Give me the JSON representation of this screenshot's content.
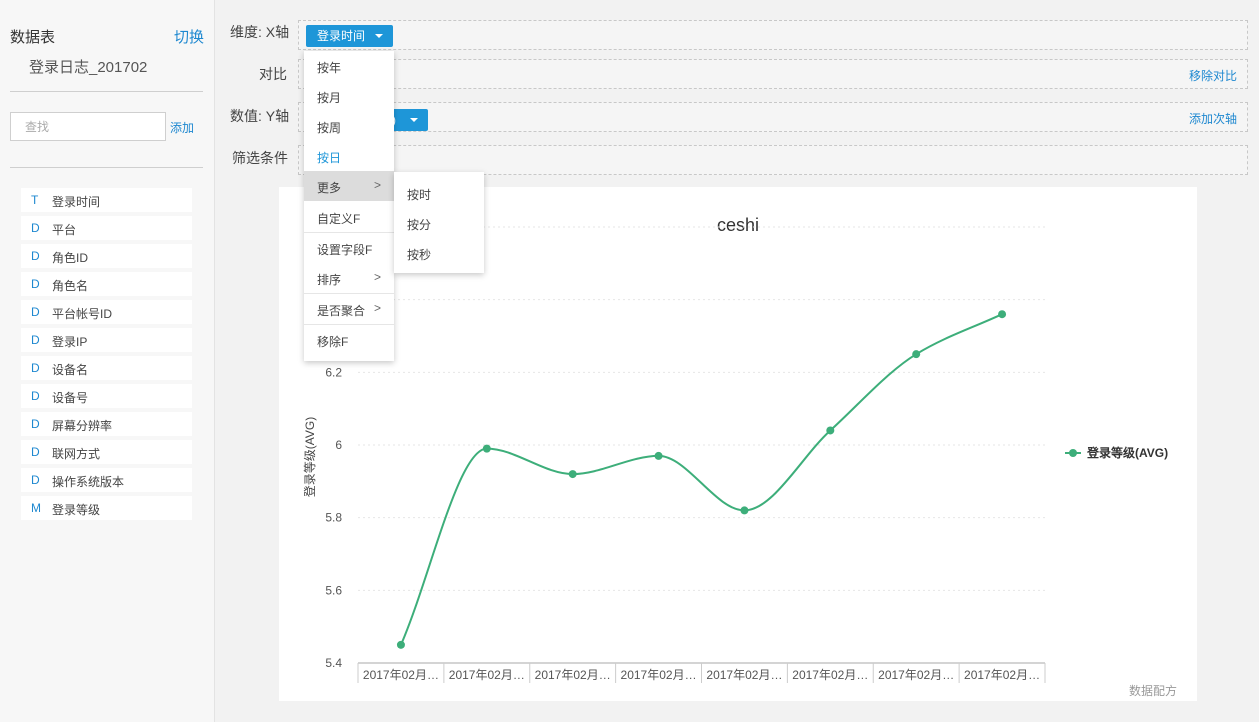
{
  "sidebar": {
    "title": "数据表",
    "switch_label": "切换",
    "table_name": "登录日志_201702",
    "search_placeholder": "查找",
    "add_label": "添加",
    "fields": [
      {
        "type": "T",
        "name": "登录时间"
      },
      {
        "type": "D",
        "name": "平台"
      },
      {
        "type": "D",
        "name": "角色ID"
      },
      {
        "type": "D",
        "name": "角色名"
      },
      {
        "type": "D",
        "name": "平台帐号ID"
      },
      {
        "type": "D",
        "name": "登录IP"
      },
      {
        "type": "D",
        "name": "设备名"
      },
      {
        "type": "D",
        "name": "设备号"
      },
      {
        "type": "D",
        "name": "屏幕分辨率"
      },
      {
        "type": "D",
        "name": "联网方式"
      },
      {
        "type": "D",
        "name": "操作系统版本"
      },
      {
        "type": "M",
        "name": "登录等级"
      }
    ]
  },
  "config": {
    "x_axis_label": "维度: X轴",
    "x_pill": "登录时间",
    "compare_label": "对比",
    "remove_compare": "移除对比",
    "y_axis_label": "数值: Y轴",
    "y_pill": ")",
    "add_secondary_axis": "添加次轴",
    "filter_label": "筛选条件"
  },
  "menu": {
    "items": [
      {
        "label": "按年"
      },
      {
        "label": "按月"
      },
      {
        "label": "按周"
      },
      {
        "label": "按日",
        "active": true
      },
      {
        "label": "更多",
        "arrow": ">",
        "hover": true
      },
      {
        "label": "自定义F"
      },
      {
        "label": "设置字段F"
      },
      {
        "label": "排序",
        "arrow": ">"
      },
      {
        "label": "是否聚合",
        "arrow": ">"
      },
      {
        "label": "移除F"
      }
    ],
    "submenu": [
      {
        "label": "按时"
      },
      {
        "label": "按分"
      },
      {
        "label": "按秒"
      }
    ]
  },
  "chart_data": {
    "type": "line",
    "title": "ceshi",
    "ylabel": "登录等级(AVG)",
    "categories": [
      "2017年02月…",
      "2017年02月…",
      "2017年02月…",
      "2017年02月…",
      "2017年02月…",
      "2017年02月…",
      "2017年02月…",
      "2017年02月…"
    ],
    "series": [
      {
        "name": "登录等级(AVG)",
        "values": [
          5.45,
          5.99,
          5.92,
          5.97,
          5.82,
          6.04,
          6.25,
          6.36
        ],
        "color": "#3dae7a"
      }
    ],
    "yticks": [
      5.4,
      5.6,
      5.8,
      6,
      6.2
    ],
    "ylim": [
      5.4,
      6.6
    ],
    "legend": "right",
    "grid": true,
    "footer_link": "数据配方"
  }
}
